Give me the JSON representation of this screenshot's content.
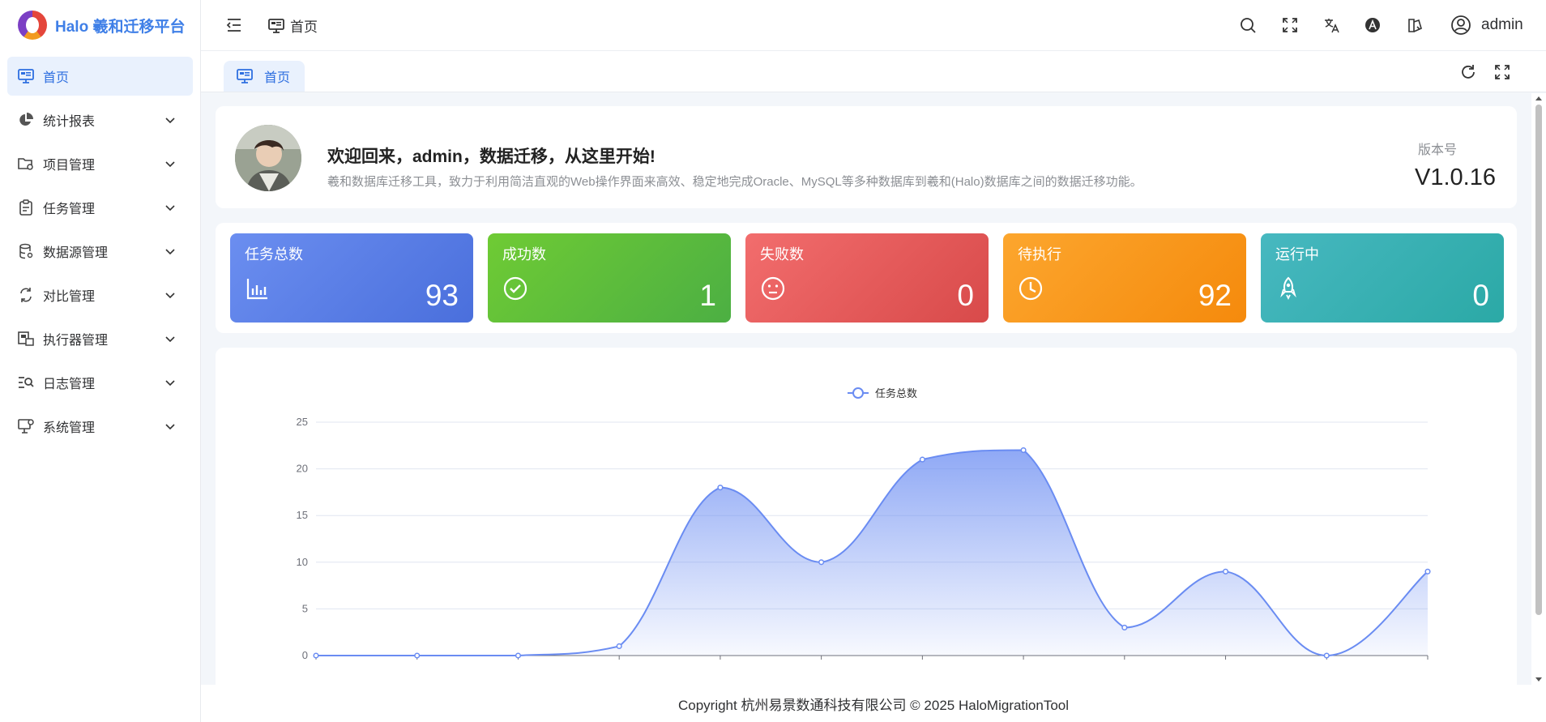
{
  "app": {
    "title": "Halo 羲和迁移平台"
  },
  "sidebar": {
    "items": [
      {
        "label": "首页",
        "icon": "monitor-icon",
        "active": true
      },
      {
        "label": "统计报表",
        "icon": "pie-chart-icon"
      },
      {
        "label": "项目管理",
        "icon": "folder-settings-icon"
      },
      {
        "label": "任务管理",
        "icon": "clipboard-icon"
      },
      {
        "label": "数据源管理",
        "icon": "database-icon"
      },
      {
        "label": "对比管理",
        "icon": "compare-icon"
      },
      {
        "label": "执行器管理",
        "icon": "executor-icon"
      },
      {
        "label": "日志管理",
        "icon": "log-search-icon"
      },
      {
        "label": "系统管理",
        "icon": "system-settings-icon"
      }
    ]
  },
  "header": {
    "breadcrumb": "首页",
    "user": "admin"
  },
  "tabs": [
    {
      "label": "首页",
      "active": true
    }
  ],
  "welcome": {
    "title": "欢迎回来，admin，数据迁移，从这里开始!",
    "subtitle": "羲和数据库迁移工具，致力于利用简洁直观的Web操作界面来高效、稳定地完成Oracle、MySQL等多种数据库到羲和(Halo)数据库之间的数据迁移功能。",
    "version_label": "版本号",
    "version": "V1.0.16"
  },
  "stats": [
    {
      "label": "任务总数",
      "value": "93",
      "icon": "bar-chart-icon",
      "color": "#5b7fe8"
    },
    {
      "label": "成功数",
      "value": "1",
      "icon": "check-circle-icon",
      "color": "#5dbd3c"
    },
    {
      "label": "失败数",
      "value": "0",
      "icon": "sad-face-icon",
      "color": "#e45c5c"
    },
    {
      "label": "待执行",
      "value": "92",
      "icon": "clock-icon",
      "color": "#f7960f"
    },
    {
      "label": "运行中",
      "value": "0",
      "icon": "rocket-icon",
      "color": "#39b1b3"
    }
  ],
  "chart_data": {
    "type": "area",
    "title": "",
    "xlabel": "",
    "ylabel": "",
    "series": [
      {
        "name": "任务总数",
        "values": [
          0,
          0,
          0,
          1,
          18,
          10,
          21,
          22,
          3,
          9,
          0,
          9
        ]
      }
    ],
    "ylim": [
      0,
      25
    ],
    "yticks": [
      0,
      5,
      10,
      15,
      20,
      25
    ],
    "grid": true,
    "legend": "top-center",
    "color": "#6a8cf2"
  },
  "footer": {
    "text": "Copyright 杭州易景数通科技有限公司 © 2025 HaloMigrationTool"
  }
}
